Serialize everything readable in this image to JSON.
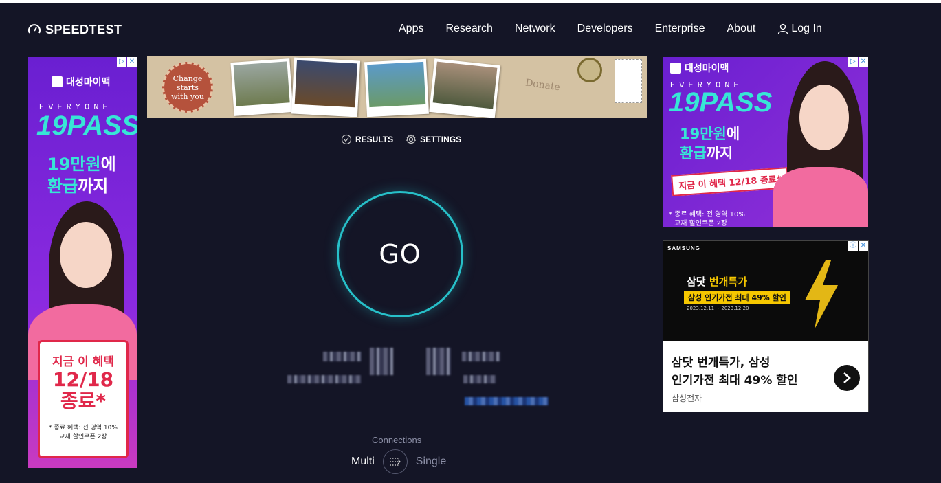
{
  "header": {
    "logo_text": "SPEEDTEST",
    "nav": [
      "Apps",
      "Research",
      "Network",
      "Developers",
      "Enterprise",
      "About"
    ],
    "login_label": "Log In"
  },
  "ads": {
    "left": {
      "brand": "대성마이맥",
      "everyone": "EVERYONE",
      "pass": "19PASS",
      "line1_hl": "19만원",
      "line1_rest": "에",
      "line2_hl": "환급",
      "line2_rest": "까지",
      "badge_line1": "지금 이 혜택",
      "badge_line2": "12/18",
      "badge_line3": "종료*",
      "footnote1": "* 종료 혜택: 전 영역 10%",
      "footnote2": "교재 할인쿠폰 2장"
    },
    "top": {
      "stamp_text": "Change starts with you",
      "donate": "Donate"
    },
    "right1": {
      "brand": "대성마이맥",
      "everyone": "EVERYONE",
      "pass": "19PASS",
      "line1_hl": "19만원",
      "line1_rest": "에",
      "line2_hl": "환급",
      "line2_rest": "까지",
      "banner": "지금 이 혜택 12/18 종료*",
      "footnote1": "* 종료 혜택: 전 영역 10%",
      "footnote2": "교재 할인쿠폰 2장"
    },
    "right2": {
      "brand": "SAMSUNG",
      "title_white": "삼닷 ",
      "title_yellow": "번개특가",
      "subtitle": "삼성 인기가전 최대 49% 할인",
      "dates": "2023.12.11 ~ 2023.12.20",
      "headline1": "삼닷 번개특가, 삼성",
      "headline2": "인기가전 최대 49% 할인",
      "advertiser": "삼성전자"
    }
  },
  "tabs": {
    "results": "RESULTS",
    "settings": "SETTINGS"
  },
  "go_label": "GO",
  "connections": {
    "title": "Connections",
    "multi": "Multi",
    "single": "Single"
  }
}
